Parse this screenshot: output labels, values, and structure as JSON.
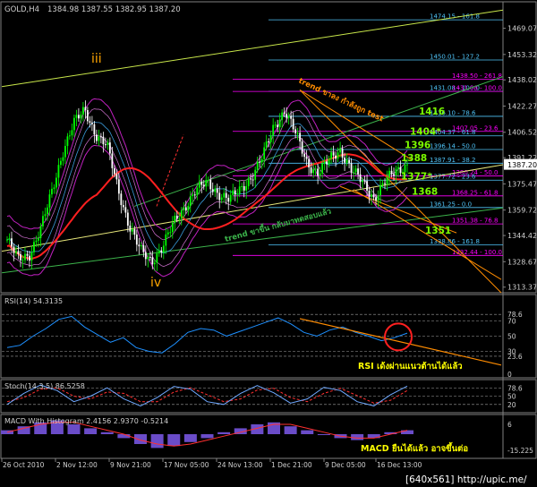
{
  "header": {
    "symbol": "GOLD,H4",
    "ohlc": "1384.98  1387.55  1382.95  1387.20"
  },
  "watermark": "[640x561] http://upic.me/",
  "colors": {
    "background": "#000000",
    "bull_candle": "#00ff00",
    "bear_candle": "#ffffff",
    "price_tag": "#ffffff",
    "fib_blue": "#4fc3f7",
    "fib_magenta": "#ff00ff",
    "trend_orange": "#ff8c00",
    "channel_green": "#3cb44b",
    "ma_red": "#ff2020",
    "bollinger": "#c020c0",
    "rsi": "#1e90ff",
    "stoch_main": "#6fa8ff",
    "stoch_signal": "#ff3030",
    "macd_hist": "#6a4cc8",
    "macd_signal": "#ff3030",
    "annotation_text": "#ffff00",
    "wave_label": "#ffa500",
    "level_label": "#7cfc00"
  },
  "chart_data": [
    {
      "panel": "price",
      "type": "candlestick",
      "title": "GOLD,H4",
      "ylim": [
        1310,
        1485
      ],
      "y_ticks": [
        1313.37,
        1328.67,
        1344.42,
        1359.72,
        1375.47,
        1391.22,
        1406.52,
        1422.27,
        1438.02,
        1453.32,
        1469.07
      ],
      "x_ticks": [
        "26 Oct 2010",
        "2 Nov 12:00",
        "9 Nov 21:00",
        "17 Nov 05:00",
        "24 Nov 13:00",
        "1 Dec 21:00",
        "9 Dec 05:00",
        "16 Dec 13:00"
      ],
      "close_path": [
        1342,
        1330,
        1333,
        1348,
        1370,
        1395,
        1412,
        1420,
        1405,
        1398,
        1372,
        1350,
        1335,
        1329,
        1338,
        1352,
        1362,
        1372,
        1376,
        1370,
        1366,
        1372,
        1380,
        1392,
        1410,
        1420,
        1405,
        1388,
        1382,
        1390,
        1396,
        1384,
        1376,
        1367,
        1377,
        1383,
        1387.2
      ],
      "current_price": "1387.20",
      "fib_levels": [
        {
          "label": "1474.15 - 161.8",
          "value": 1474.15,
          "color": "#4fc3f7"
        },
        {
          "label": "1450.01 - 127.2",
          "value": 1450.01,
          "color": "#4fc3f7"
        },
        {
          "label": "1438.50 - 261.8",
          "value": 1438.5,
          "color": "#ff00ff"
        },
        {
          "label": "1431.08 - 100.0",
          "value": 1431.08,
          "color": "#4fc3f7"
        },
        {
          "label": "1431.08 - 100.0",
          "value": 1431.08,
          "color": "#ff00ff"
        },
        {
          "label": "1416.10 - 78.6",
          "value": 1416.1,
          "color": "#4fc3f7"
        },
        {
          "label": "1407.05 - 23.6",
          "value": 1407.05,
          "color": "#ff00ff"
        },
        {
          "label": "1404.37 - 61.8",
          "value": 1404.37,
          "color": "#4fc3f7"
        },
        {
          "label": "1396.14 - 50.0",
          "value": 1396.14,
          "color": "#4fc3f7"
        },
        {
          "label": "1387.91 - 38.2",
          "value": 1387.91,
          "color": "#4fc3f7"
        },
        {
          "label": "1380.24 - 50.0",
          "value": 1380.24,
          "color": "#ff00ff"
        },
        {
          "label": "1377.72 - 23.6",
          "value": 1377.72,
          "color": "#4fc3f7"
        },
        {
          "label": "1368.25 - 61.8",
          "value": 1368.25,
          "color": "#ff00ff"
        },
        {
          "label": "1361.25 - 0.0",
          "value": 1361.25,
          "color": "#4fc3f7"
        },
        {
          "label": "1351.38 - 76.8",
          "value": 1351.38,
          "color": "#ff00ff"
        },
        {
          "label": "1338.86 - 161.8",
          "value": 1338.86,
          "color": "#4fc3f7"
        },
        {
          "label": "1332.44 - 100.0",
          "value": 1332.44,
          "color": "#ff00ff"
        }
      ],
      "key_levels": [
        {
          "label": "1416",
          "value": 1416
        },
        {
          "label": "1404*",
          "value": 1404
        },
        {
          "label": "1396",
          "value": 1396
        },
        {
          "label": "1388",
          "value": 1388
        },
        {
          "label": "1377*",
          "value": 1377
        },
        {
          "label": "1368",
          "value": 1368
        },
        {
          "label": "1351",
          "value": 1351
        }
      ],
      "wave_labels": [
        "iii",
        "iv"
      ],
      "annotations": [
        "trend ขาลง กำลังถูก test",
        "trend ขาขึ้น กลับมาทดสอบแล้ว"
      ]
    },
    {
      "panel": "rsi",
      "type": "line",
      "title": "RSI(14) 54.3135",
      "ylim": [
        0,
        100
      ],
      "y_ticks": [
        "78.6",
        "70",
        "50",
        "30",
        "23.6",
        "0"
      ],
      "levels": [
        78.6,
        70,
        50,
        30,
        23.6
      ],
      "values": [
        35,
        38,
        50,
        60,
        72,
        76,
        62,
        52,
        42,
        48,
        35,
        30,
        28,
        40,
        55,
        60,
        58,
        50,
        56,
        62,
        68,
        74,
        66,
        55,
        50,
        58,
        62,
        55,
        50,
        44,
        48,
        54
      ],
      "annotation": "RSI เด้งผ่านแนวต้านได้แล้ว"
    },
    {
      "panel": "stochastic",
      "type": "line",
      "title": "Stoch(14,3,5) 86.5258",
      "ylim": [
        0,
        100
      ],
      "y_ticks": [
        "78.6",
        "50",
        "20"
      ],
      "levels": [
        78.6,
        50,
        20
      ],
      "main": [
        20,
        60,
        90,
        70,
        30,
        50,
        80,
        40,
        15,
        45,
        85,
        75,
        30,
        20,
        60,
        88,
        62,
        25,
        40,
        82,
        70,
        30,
        15,
        55,
        86
      ],
      "signal": [
        30,
        45,
        75,
        80,
        50,
        40,
        65,
        60,
        30,
        30,
        65,
        80,
        55,
        30,
        40,
        72,
        78,
        45,
        30,
        60,
        78,
        52,
        25,
        35,
        70
      ]
    },
    {
      "panel": "macd",
      "type": "bar",
      "title": "MACD With Histogram 2.4156 2.9370 -0.5214",
      "y_ticks": [
        "6",
        "-15.225"
      ],
      "histogram": [
        2,
        4,
        6,
        7,
        5,
        3,
        1,
        -2,
        -5,
        -7,
        -6,
        -4,
        -2,
        1,
        3,
        5,
        6,
        4,
        2,
        0,
        -2,
        -3,
        -2,
        1,
        2
      ],
      "signal_line": [
        1,
        3,
        5,
        6,
        6,
        4,
        2,
        0,
        -3,
        -5,
        -6,
        -5,
        -3,
        -1,
        1,
        3,
        5,
        5,
        3,
        1,
        -1,
        -2,
        -2,
        0,
        2
      ],
      "annotation": "MACD ยืนได้แล้ว อาจขึ้นต่อ"
    }
  ]
}
